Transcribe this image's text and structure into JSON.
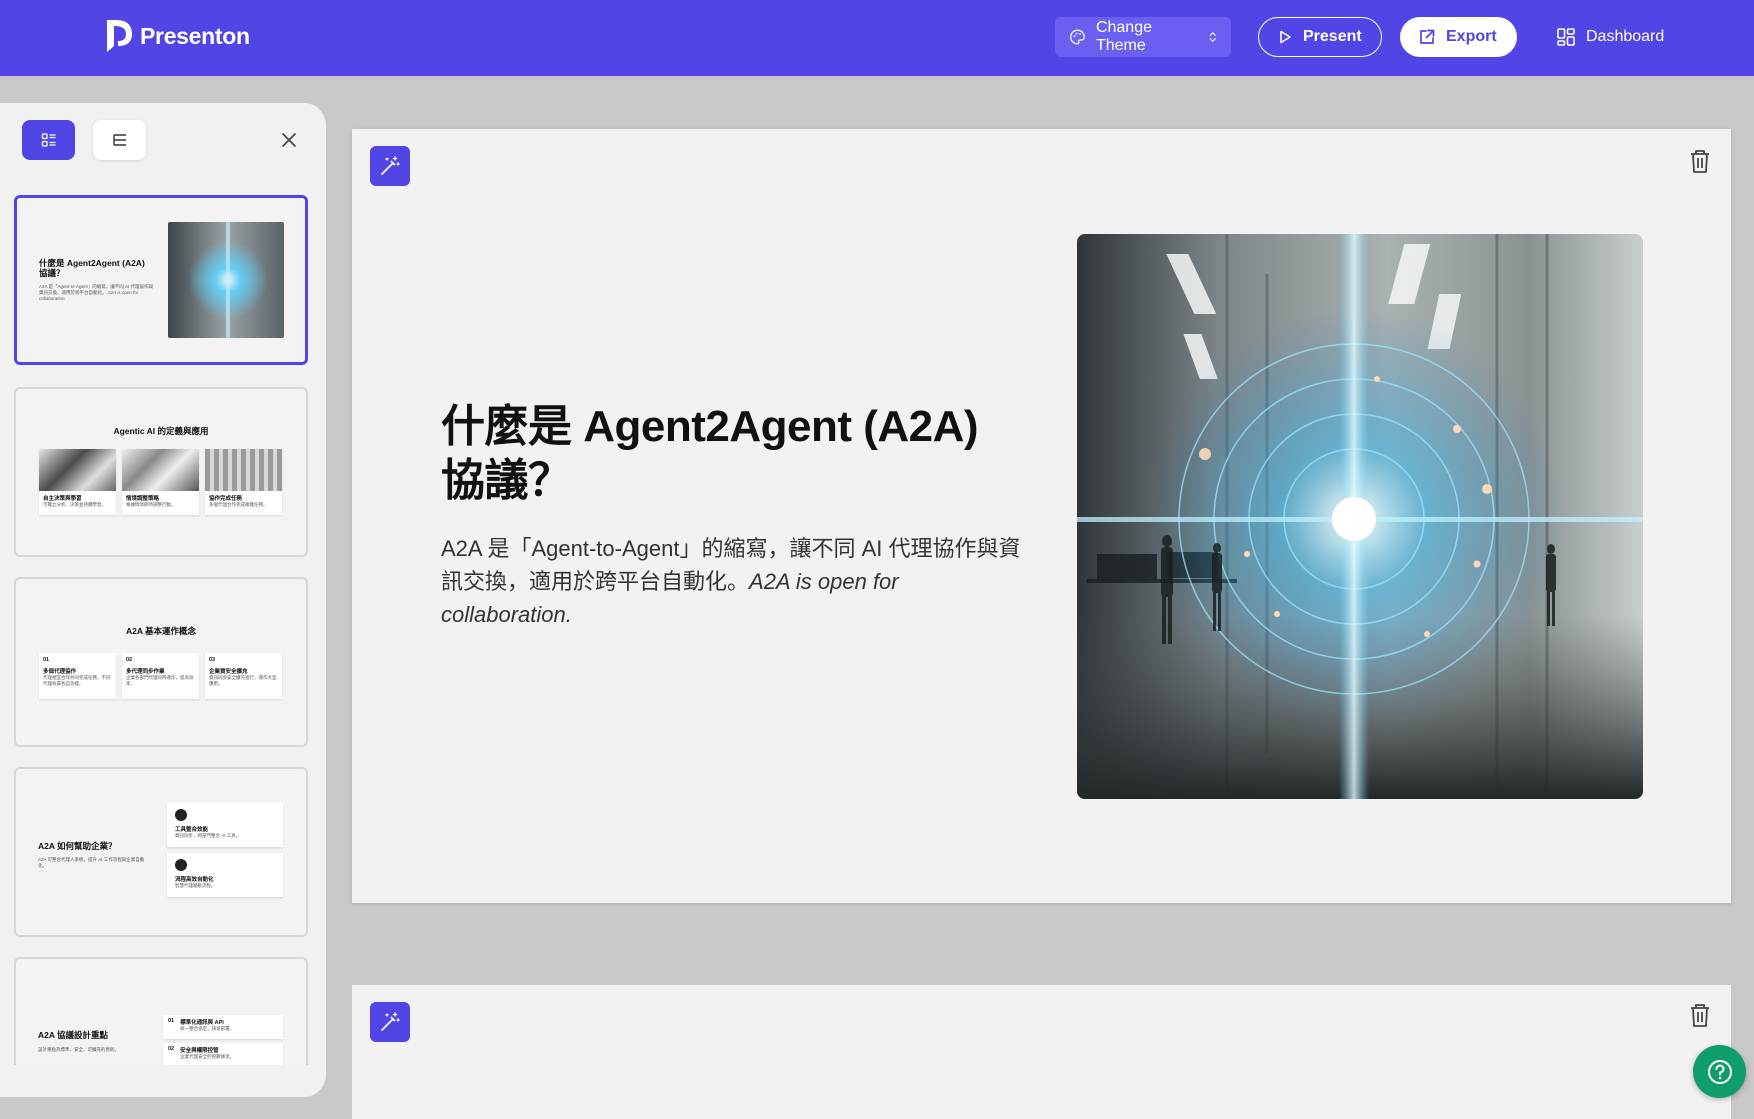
{
  "header": {
    "brand": "Presenton",
    "change_theme": "Change Theme",
    "present": "Present",
    "export": "Export",
    "dashboard": "Dashboard"
  },
  "colors": {
    "primary": "#5146e5",
    "help": "#0f9d6a"
  },
  "sidebar": {
    "thumbnails": [
      {
        "title": "什麼是 Agent2Agent (A2A) 協議？",
        "body": "A2A 是「Agent-to-Agent」的縮寫，讓不同 AI 代理協作與資訊交換，適用於跨平台自動化。",
        "body_italic": "A2A is open for collaboration."
      },
      {
        "title": "Agentic AI 的定義與應用",
        "cards": [
          {
            "title": "自主決策與學習",
            "text": "可獨立分析、決策並持續學習。"
          },
          {
            "title": "情境調整策略",
            "text": "根據情境即時調整行動。"
          },
          {
            "title": "協作完成任務",
            "text": "多個代理合作完成複雜任務。"
          }
        ]
      },
      {
        "title": "A2A 基本運作概念",
        "cards": [
          {
            "num": "01",
            "title": "多個代理協作",
            "text": "代理相互合作共同完成任務，不同代理負責各自功能。"
          },
          {
            "num": "02",
            "title": "多代理同步作業",
            "text": "企業各部門代理同時運作，提高效率。"
          },
          {
            "num": "03",
            "title": "企業資安全擴充",
            "text": "資訊同步安全擴充進行，運作大型應用。"
          }
        ]
      },
      {
        "title": "A2A 如何幫助企業？",
        "body": "A2A 可整合代理人系統，提升 AI 工作流程與企業自動化。",
        "cards": [
          {
            "title": "工具整合效能",
            "text": "資訊同步，跨部門整合 AI 工具。"
          },
          {
            "title": "流程高效自動化",
            "text": "智慧代理驅動流程。"
          }
        ]
      },
      {
        "title": "A2A 協議設計重點",
        "body": "設計重點為標準、安全、可擴充的原則。",
        "cards": [
          {
            "num": "01",
            "title": "標準化通訊與 API",
            "text": "統一整合協定，快速部署。"
          },
          {
            "num": "02",
            "title": "安全與權限控管",
            "text": "企業代理安全控管數據流。"
          }
        ]
      }
    ]
  },
  "slide": {
    "title": "什麼是 Agent2Agent (A2A) 協議？",
    "body": "A2A 是「Agent-to-Agent」的縮寫，讓不同 AI 代理協作與資訊交換，適用於跨平台自動化。",
    "body_italic": "A2A is open for collaboration."
  }
}
